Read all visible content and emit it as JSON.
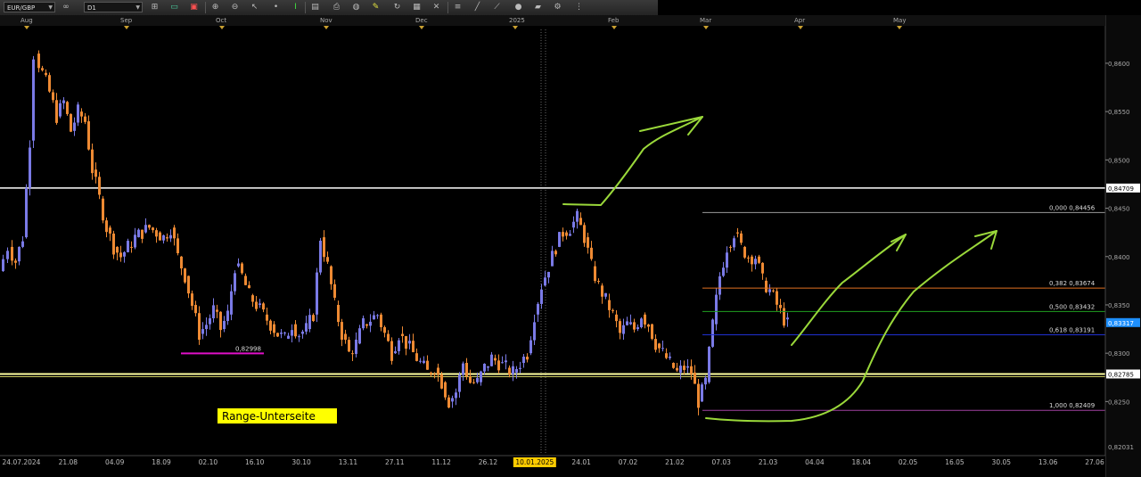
{
  "toolbar": {
    "symbol": "EUR/GBP",
    "timeframe": "D1",
    "icons": [
      "infinity-icon",
      "chart-type-icon",
      "crosshair-icon",
      "color-icon",
      "zoom-in-icon",
      "zoom-out-icon",
      "cursor-icon",
      "dot-icon",
      "cursor-text-icon",
      "template-icon",
      "print-icon",
      "globe-icon",
      "pencil-icon",
      "refresh-icon",
      "camera-icon",
      "cross-tool-icon",
      "channel-icon",
      "fib-tool-icon",
      "trend-tool-icon",
      "sphere-icon",
      "eraser-icon",
      "gear-icon",
      "more-icon"
    ]
  },
  "chart_data": {
    "type": "candlestick",
    "symbol": "EUR/GBP",
    "timeframe": "D1",
    "ylim": [
      0.8195,
      0.8635
    ],
    "y_ticks": [
      "0,8600",
      "0,8550",
      "0,8500",
      "0,8450",
      "0,8400",
      "0,8350",
      "0,8300",
      "0,8250"
    ],
    "month_labels": [
      {
        "label": "Aug",
        "x": 30
      },
      {
        "label": "Sep",
        "x": 142
      },
      {
        "label": "Oct",
        "x": 249
      },
      {
        "label": "Nov",
        "x": 366
      },
      {
        "label": "Dec",
        "x": 473
      },
      {
        "label": "2025",
        "x": 578
      },
      {
        "label": "Feb",
        "x": 689
      },
      {
        "label": "Mar",
        "x": 792
      },
      {
        "label": "Apr",
        "x": 898
      },
      {
        "label": "May",
        "x": 1009
      }
    ],
    "date_labels": [
      "24.07.2024",
      "21.08",
      "04.09",
      "18.09",
      "02.10",
      "16.10",
      "30.10",
      "13.11",
      "27.11",
      "11.12",
      "26.12",
      "10.01.2025",
      "24.01",
      "07.02",
      "21.02",
      "07.03",
      "21.03",
      "04.04",
      "18.04",
      "02.05",
      "16.05",
      "30.05",
      "13.06",
      "27.06"
    ],
    "highlighted_date": "10.01.2025",
    "horizontal_levels": [
      {
        "label": "0,84709",
        "value": 0.84709,
        "color": "#ffffff",
        "axis_box": "#ffffff",
        "axis_text": "#000000"
      },
      {
        "label": "0,82785",
        "value": 0.82785,
        "color": "#ffffa0",
        "axis_box": "#ffffff",
        "axis_text": "#000000"
      }
    ],
    "current_price": {
      "label": "0,83317",
      "value": 0.83317,
      "color": "#1e90ff"
    },
    "bottom_price": {
      "label": "0,82031",
      "value": 0.82031
    },
    "marker_line": {
      "label": "0,82998",
      "value": 0.82998,
      "color": "#e010c8"
    },
    "fibonacci": [
      {
        "label": "0,000 0,84456",
        "value": 0.84456,
        "color": "#9a9a9a"
      },
      {
        "label": "0,382 0,83674",
        "value": 0.83674,
        "color": "#e07020"
      },
      {
        "label": "0,500 0,83432",
        "value": 0.83432,
        "color": "#20a020"
      },
      {
        "label": "0,618 0,83191",
        "value": 0.83191,
        "color": "#2030d0"
      },
      {
        "label": "1,000 0,82409",
        "value": 0.82409,
        "color": "#a040a0"
      }
    ],
    "annotation": {
      "text": "Range-Unterseite",
      "background": "#ffff00",
      "color": "#000000"
    },
    "colors": {
      "up": "#7a7ae6",
      "down": "#ee8a33",
      "background": "#000000"
    }
  }
}
